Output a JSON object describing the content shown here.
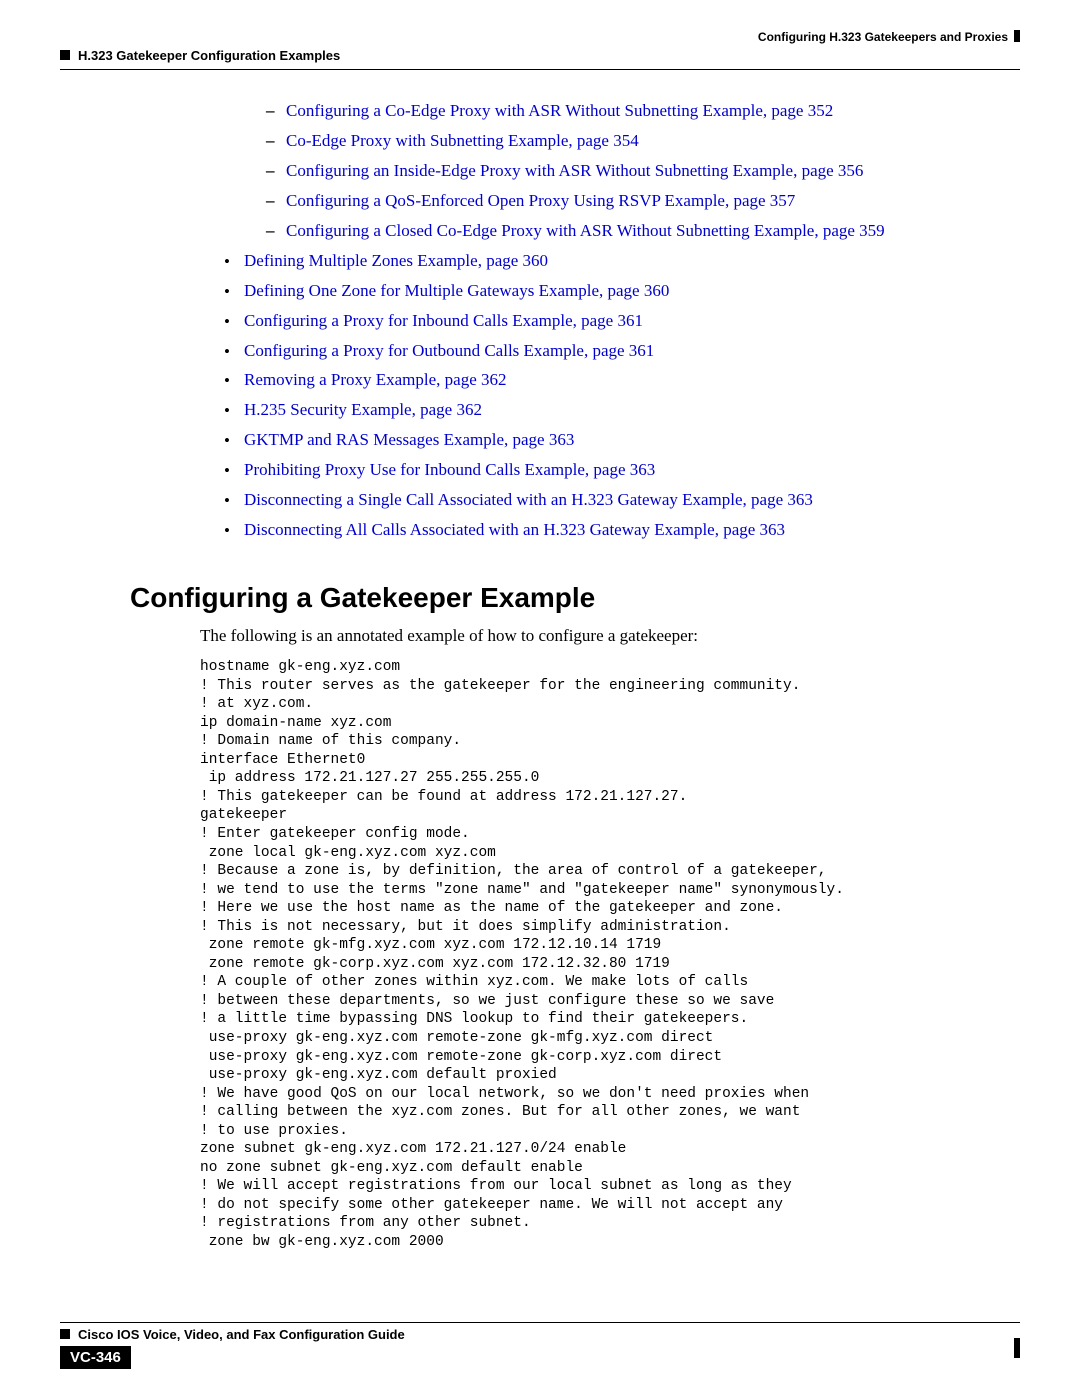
{
  "header": {
    "right": "Configuring H.323 Gatekeepers and Proxies",
    "left": "H.323 Gatekeeper Configuration Examples"
  },
  "nested_links": [
    "Configuring a Co-Edge Proxy with ASR Without Subnetting Example, page 352",
    "Co-Edge Proxy with Subnetting Example, page 354",
    "Configuring an Inside-Edge Proxy with ASR Without Subnetting Example, page 356",
    "Configuring a QoS-Enforced Open Proxy Using RSVP Example, page 357",
    "Configuring a Closed Co-Edge Proxy with ASR Without Subnetting Example, page 359"
  ],
  "bullet_links": [
    "Defining Multiple Zones Example, page 360",
    "Defining One Zone for Multiple Gateways Example, page 360",
    "Configuring a Proxy for Inbound Calls Example, page 361",
    "Configuring a Proxy for Outbound Calls Example, page 361",
    "Removing a Proxy Example, page 362",
    "H.235 Security Example, page 362",
    "GKTMP and RAS Messages Example, page 363",
    "Prohibiting Proxy Use for Inbound Calls Example, page 363",
    "Disconnecting a Single Call Associated with an H.323 Gateway Example, page 363",
    "Disconnecting All Calls Associated with an H.323 Gateway Example, page 363"
  ],
  "section_heading": "Configuring a Gatekeeper Example",
  "intro_text": "The following is an annotated example of how to configure a gatekeeper:",
  "code_block": "hostname gk-eng.xyz.com\n! This router serves as the gatekeeper for the engineering community.\n! at xyz.com.\nip domain-name xyz.com\n! Domain name of this company.\ninterface Ethernet0\n ip address 172.21.127.27 255.255.255.0\n! This gatekeeper can be found at address 172.21.127.27.\ngatekeeper\n! Enter gatekeeper config mode.\n zone local gk-eng.xyz.com xyz.com\n! Because a zone is, by definition, the area of control of a gatekeeper,\n! we tend to use the terms \"zone name\" and \"gatekeeper name\" synonymously.\n! Here we use the host name as the name of the gatekeeper and zone.\n! This is not necessary, but it does simplify administration.\n zone remote gk-mfg.xyz.com xyz.com 172.12.10.14 1719\n zone remote gk-corp.xyz.com xyz.com 172.12.32.80 1719\n! A couple of other zones within xyz.com. We make lots of calls\n! between these departments, so we just configure these so we save\n! a little time bypassing DNS lookup to find their gatekeepers.\n use-proxy gk-eng.xyz.com remote-zone gk-mfg.xyz.com direct\n use-proxy gk-eng.xyz.com remote-zone gk-corp.xyz.com direct\n use-proxy gk-eng.xyz.com default proxied\n! We have good QoS on our local network, so we don't need proxies when\n! calling between the xyz.com zones. But for all other zones, we want\n! to use proxies.\nzone subnet gk-eng.xyz.com 172.21.127.0/24 enable\nno zone subnet gk-eng.xyz.com default enable\n! We will accept registrations from our local subnet as long as they\n! do not specify some other gatekeeper name. We will not accept any\n! registrations from any other subnet.\n zone bw gk-eng.xyz.com 2000",
  "footer": {
    "title": "Cisco IOS Voice, Video, and Fax Configuration Guide",
    "page": "VC-346"
  }
}
